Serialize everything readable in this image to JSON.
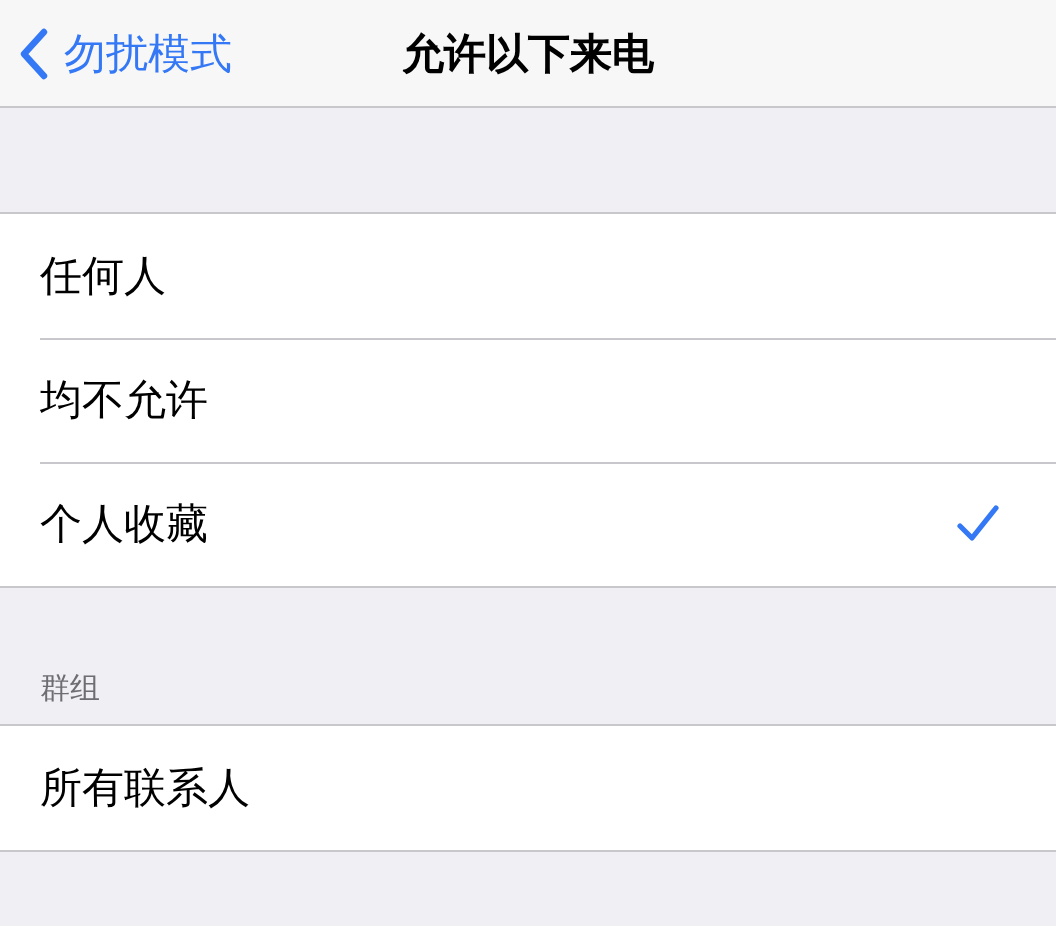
{
  "nav": {
    "back_label": "勿扰模式",
    "title": "允许以下来电"
  },
  "sections": [
    {
      "items": [
        {
          "label": "任何人",
          "selected": false
        },
        {
          "label": "均不允许",
          "selected": false
        },
        {
          "label": "个人收藏",
          "selected": true
        }
      ]
    },
    {
      "header": "群组",
      "items": [
        {
          "label": "所有联系人",
          "selected": false
        }
      ]
    }
  ]
}
